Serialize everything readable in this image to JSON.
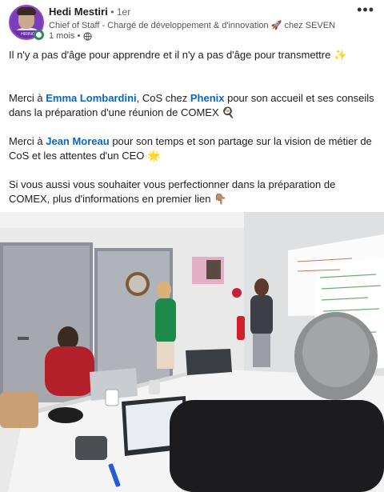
{
  "post": {
    "author": "Hedi Mestiri",
    "degree": "• 1er",
    "headline": "Chief of Staff - Chargé de développement & d'innovation 🚀 chez SEVEN",
    "time": "1 mois •",
    "more_label": "•••",
    "avatar_banner": "HIRING"
  },
  "content": {
    "line1": "Il n'y a pas d'âge pour apprendre et il n'y a pas d'âge pour transmettre ✨",
    "p2_prefix": "Merci à ",
    "p2_mention1": "Emma Lombardini",
    "p2_mid": ", CoS chez ",
    "p2_mention2": "Phenix",
    "p2_suffix": " pour son accueil et ses conseils dans la préparation d'une réunion de COMEX 🍳",
    "p3_prefix": "Merci à ",
    "p3_mention": "Jean Moreau",
    "p3_suffix": " pour son temps et son partage sur la vision de métier de CoS et les attentes d'un CEO 🌟",
    "p4": "Si vous aussi vous souhaiter vous perfectionner dans la préparation de COMEX, plus d'informations en premier lien 👇🏽"
  },
  "colors": {
    "mention": "#0a66c2",
    "online": "#2e8b57",
    "avatar_bg": "#7a3fb8"
  },
  "icons": {
    "globe": "globe-icon",
    "more": "more-options-icon"
  }
}
